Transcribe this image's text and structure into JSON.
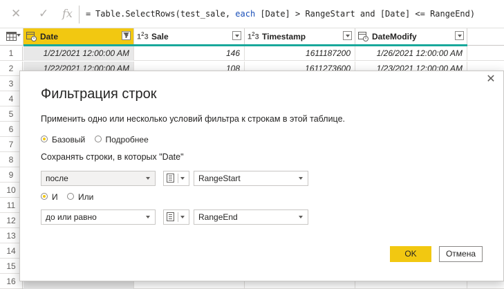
{
  "formula_bar": {
    "cancel_icon": "x-icon",
    "commit_icon": "check-icon",
    "fx_label": "fx",
    "eq": "=",
    "formula_pre": "Table.SelectRows(test_sale, ",
    "formula_kw": "each",
    "formula_post": " [Date] > RangeStart and [Date] <= RangeEnd)"
  },
  "grid": {
    "columns": [
      {
        "type_icon": "calendar-clock-icon",
        "label": "Date"
      },
      {
        "type_icon": "123",
        "label": "Sale"
      },
      {
        "type_icon": "123",
        "label": "Timestamp"
      },
      {
        "type_icon": "calendar-clock-icon",
        "label": "DateModify"
      }
    ],
    "rows": [
      {
        "num": "1",
        "date": "1/21/2021 12:00:00 AM",
        "sale": "146",
        "timestamp": "1611187200",
        "modify": "1/26/2021 12:00:00 AM"
      },
      {
        "num": "2",
        "date": "1/22/2021 12:00:00 AM",
        "sale": "108",
        "timestamp": "1611273600",
        "modify": "1/23/2021 12:00:00 AM"
      },
      {
        "num": "3"
      },
      {
        "num": "4"
      },
      {
        "num": "5"
      },
      {
        "num": "6"
      },
      {
        "num": "7"
      },
      {
        "num": "8"
      },
      {
        "num": "9"
      },
      {
        "num": "10"
      },
      {
        "num": "11"
      },
      {
        "num": "12"
      },
      {
        "num": "13"
      },
      {
        "num": "14"
      },
      {
        "num": "15"
      },
      {
        "num": "16"
      }
    ],
    "accent": "#f2c811",
    "quality_color": "#18a89b"
  },
  "dialog": {
    "title": "Фильтрация строк",
    "description": "Применить одно или несколько условий фильтра к строкам в этой таблице.",
    "mode": {
      "basic": "Базовый",
      "advanced": "Подробнее",
      "selected": "basic"
    },
    "keep_rows_label": "Сохранять строки, в которых \"Date\"",
    "condition1": {
      "operator": "после",
      "value": "RangeStart"
    },
    "logic": {
      "and": "И",
      "or": "Или",
      "selected": "and"
    },
    "condition2": {
      "operator": "до или равно",
      "value": "RangeEnd"
    },
    "ok_label": "OK",
    "cancel_label": "Отмена"
  }
}
